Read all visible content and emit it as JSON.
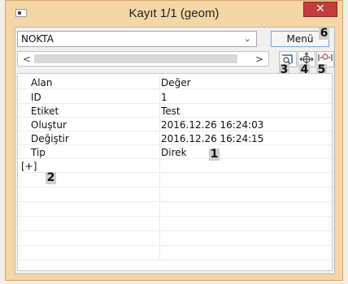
{
  "window": {
    "title": "Kayıt 1/1 (geom)",
    "close_glyph": "✕"
  },
  "toolbar": {
    "layer_value": "NOKTA",
    "menu_label": "Menü",
    "scroll_left": "<",
    "scroll_right": ">",
    "chevron": "⌄"
  },
  "annotations": [
    "1",
    "2",
    "3",
    "4",
    "5",
    "6"
  ],
  "grid": {
    "headers": [
      "Alan",
      "Değer"
    ],
    "rows": [
      [
        "ID",
        "1"
      ],
      [
        "Etiket",
        "Test"
      ],
      [
        "Oluştur",
        "2016.12.26 16:24:03"
      ],
      [
        "Değiştir",
        "2016.12.26 16:24:15"
      ],
      [
        "Tip",
        "Direk"
      ],
      [
        "[+]",
        ""
      ]
    ]
  },
  "colors": {
    "frame": "#f5d6a6",
    "close": "#c43c3c",
    "menu_border": "#7ea7d8"
  },
  "icons": [
    "app-icon",
    "close-icon",
    "chevron-down-icon",
    "zoom-to-feature-icon",
    "pan-to-feature-icon",
    "identify-icon"
  ]
}
